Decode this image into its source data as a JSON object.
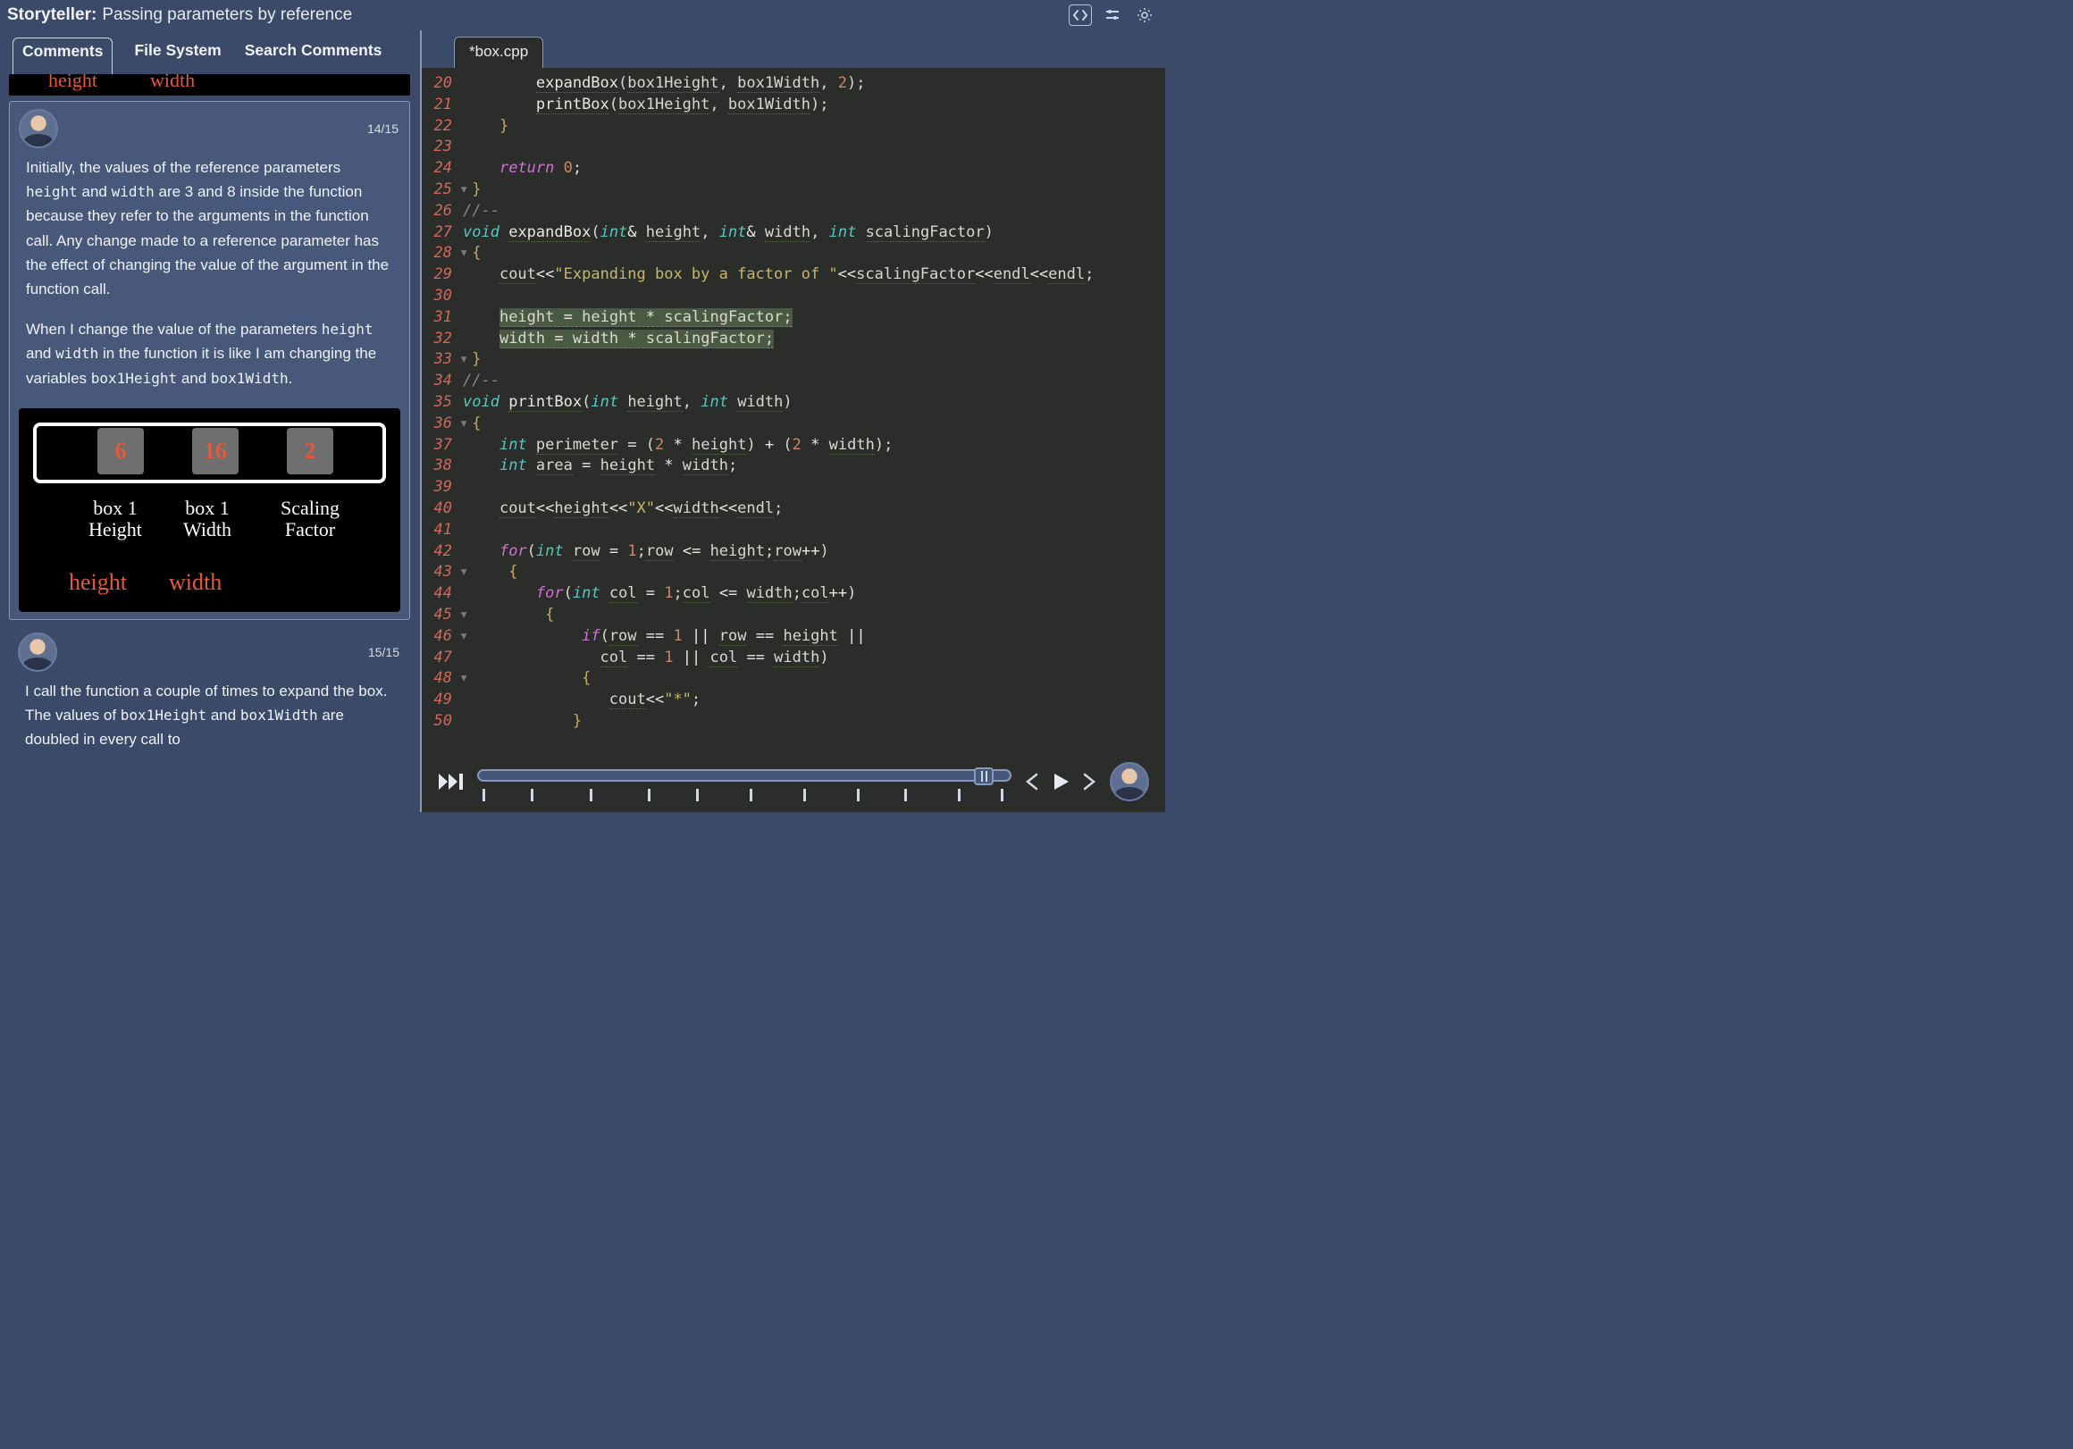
{
  "header": {
    "app_title": "Storyteller:",
    "subtitle": "Passing parameters by reference"
  },
  "left_panel": {
    "tabs": [
      "Comments",
      "File System",
      "Search Comments"
    ],
    "active_tab_index": 0,
    "partial_sketch_top": {
      "label1": "height",
      "label2": "width"
    },
    "comment14": {
      "counter": "14/15",
      "p1a": "Initially, the values of the reference parameters ",
      "c1": "height",
      "p1b": " and ",
      "c2": "width",
      "p1c": " are 3 and 8 inside the function because they refer to the arguments in the function call. Any change made to a reference parameter has the effect of changing the value of the argument in the function call.",
      "p2a": "When I change the value of the parameters ",
      "c3": "height",
      "p2b": " and ",
      "c4": "width",
      "p2c": " in the function it is like I am changing the variables ",
      "c5": "box1Height",
      "p2d": " and ",
      "c6": "box1Width",
      "p2e": ".",
      "sketch": {
        "cell1": "6",
        "cell2": "16",
        "cell3": "2",
        "lbl1a": "box 1",
        "lbl1b": "Height",
        "lbl2a": "box 1",
        "lbl2b": "Width",
        "lbl3a": "Scaling",
        "lbl3b": "Factor",
        "r1": "height",
        "r2": "width"
      }
    },
    "comment15": {
      "counter": "15/15",
      "p1a": "I call the function a couple of times to expand the box. The values of ",
      "c1": "box1Height",
      "p1b": " and ",
      "c2": "box1Width",
      "p1c": " are doubled in every call to "
    }
  },
  "editor": {
    "tab_label": "*box.cpp",
    "lines": [
      {
        "n": 20,
        "html": "        <span class='fn dash'>expandBox</span>(<span class='dash'>box1Height</span>, <span class='dash'>box1Width</span>, <span class='num'>2</span>);"
      },
      {
        "n": 21,
        "html": "        <span class='fn dash'>printBox</span>(<span class='dash'>box1Height</span>, <span class='dash'>box1Width</span>);"
      },
      {
        "n": 22,
        "html": "    <span class='br'>}</span>"
      },
      {
        "n": 23,
        "html": " "
      },
      {
        "n": 24,
        "html": "    <span class='kw'>return</span> <span class='num'>0</span>;"
      },
      {
        "n": 25,
        "fold": "-",
        "html": "<span class='br'>}</span>"
      },
      {
        "n": 26,
        "html": "<span class='cmt'>//--</span>"
      },
      {
        "n": 27,
        "html": "<span class='ty'>void</span> <span class='fn dash'>expandBox</span>(<span class='ty'>int</span><span class='op'>&amp;</span> <span class='dash'>height</span>, <span class='ty'>int</span><span class='op'>&amp;</span> <span class='dash'>width</span>, <span class='ty'>int</span> <span class='dash'>scalingFactor</span>)"
      },
      {
        "n": 28,
        "fold": "-",
        "html": "<span class='br'>{</span>"
      },
      {
        "n": 29,
        "html": "    <span class='dash'>cout</span><span class='op'>&lt;&lt;</span><span class='str'>\"Expanding box by a factor of \"</span><span class='op'>&lt;&lt;</span><span class='dash'>scalingFactor</span><span class='op'>&lt;&lt;</span><span class='dash'>endl</span><span class='op'>&lt;&lt;</span><span class='dash'>endl</span>;"
      },
      {
        "n": 30,
        "html": " "
      },
      {
        "n": 31,
        "html": "    <span class='hl'><span class='dash'>height</span> <span class='op'>=</span> <span class='dash'>height</span> <span class='op'>*</span> <span class='dash'>scalingFactor</span>;</span>"
      },
      {
        "n": 32,
        "html": "    <span class='hl'><span class='dash'>width</span> <span class='op'>=</span> <span class='dash'>width</span> <span class='op'>*</span> <span class='dash'>scalingFactor</span>;</span>"
      },
      {
        "n": 33,
        "fold": "-",
        "html": "<span class='br'>}</span>"
      },
      {
        "n": 34,
        "html": "<span class='cmt'>//--</span>"
      },
      {
        "n": 35,
        "html": "<span class='ty'>void</span> <span class='fn dash'>printBox</span>(<span class='ty'>int</span> <span class='dash'>height</span>, <span class='ty'>int</span> <span class='dash'>width</span>)"
      },
      {
        "n": 36,
        "fold": "-",
        "html": "<span class='br'>{</span>"
      },
      {
        "n": 37,
        "html": "    <span class='ty'>int</span> <span class='dash'>perimeter</span> <span class='op'>=</span> (<span class='num'>2</span> <span class='op'>*</span> <span class='dash'>height</span>) <span class='op'>+</span> (<span class='num'>2</span> <span class='op'>*</span> <span class='dash'>width</span>);"
      },
      {
        "n": 38,
        "html": "    <span class='ty'>int</span> <span class='dash'>area</span> <span class='op'>=</span> <span class='dash'>height</span> <span class='op'>*</span> <span class='dash'>width</span>;"
      },
      {
        "n": 39,
        "html": " "
      },
      {
        "n": 40,
        "html": "    <span class='dash'>cout</span><span class='op'>&lt;&lt;</span><span class='dash'>height</span><span class='op'>&lt;&lt;</span><span class='str'>\"X\"</span><span class='op'>&lt;&lt;</span><span class='dash'>width</span><span class='op'>&lt;&lt;</span><span class='dash'>endl</span>;"
      },
      {
        "n": 41,
        "html": " "
      },
      {
        "n": 42,
        "html": "    <span class='kw'>for</span>(<span class='ty'>int</span> <span class='dash'>row</span> <span class='op'>=</span> <span class='num'>1</span>;<span class='dash'>row</span> <span class='op'>&lt;=</span> <span class='dash'>height</span>;<span class='dash'>row</span><span class='op'>++</span>)"
      },
      {
        "n": 43,
        "fold": "-",
        "html": "    <span class='br'>{</span>"
      },
      {
        "n": 44,
        "html": "        <span class='kw'>for</span>(<span class='ty'>int</span> <span class='dash'>col</span> <span class='op'>=</span> <span class='num'>1</span>;<span class='dash'>col</span> <span class='op'>&lt;=</span> <span class='dash'>width</span>;<span class='dash'>col</span><span class='op'>++</span>)"
      },
      {
        "n": 45,
        "fold": "-",
        "html": "        <span class='br'>{</span>"
      },
      {
        "n": 46,
        "fold": "-",
        "html": "            <span class='kw'>if</span>(<span class='dash'>row</span> <span class='op'>==</span> <span class='num'>1</span> <span class='op'>||</span> <span class='dash'>row</span> <span class='op'>==</span> <span class='dash'>height</span> <span class='op'>||</span>"
      },
      {
        "n": 47,
        "html": "               <span class='dash'>col</span> <span class='op'>==</span> <span class='num'>1</span> <span class='op'>||</span> <span class='dash'>col</span> <span class='op'>==</span> <span class='dash'>width</span>)"
      },
      {
        "n": 48,
        "fold": "-",
        "html": "            <span class='br'>{</span>"
      },
      {
        "n": 49,
        "html": "                <span class='dash'>cout</span><span class='op'>&lt;&lt;</span><span class='str'>\"*\"</span>;"
      },
      {
        "n": 50,
        "html": "            <span class='br'>}</span>"
      }
    ]
  },
  "playback": {
    "progress_percent": 94,
    "tick_positions_pct": [
      1,
      10,
      21,
      32,
      41,
      51,
      61,
      71,
      80,
      90,
      98
    ],
    "thumb_left_pct": 93
  }
}
